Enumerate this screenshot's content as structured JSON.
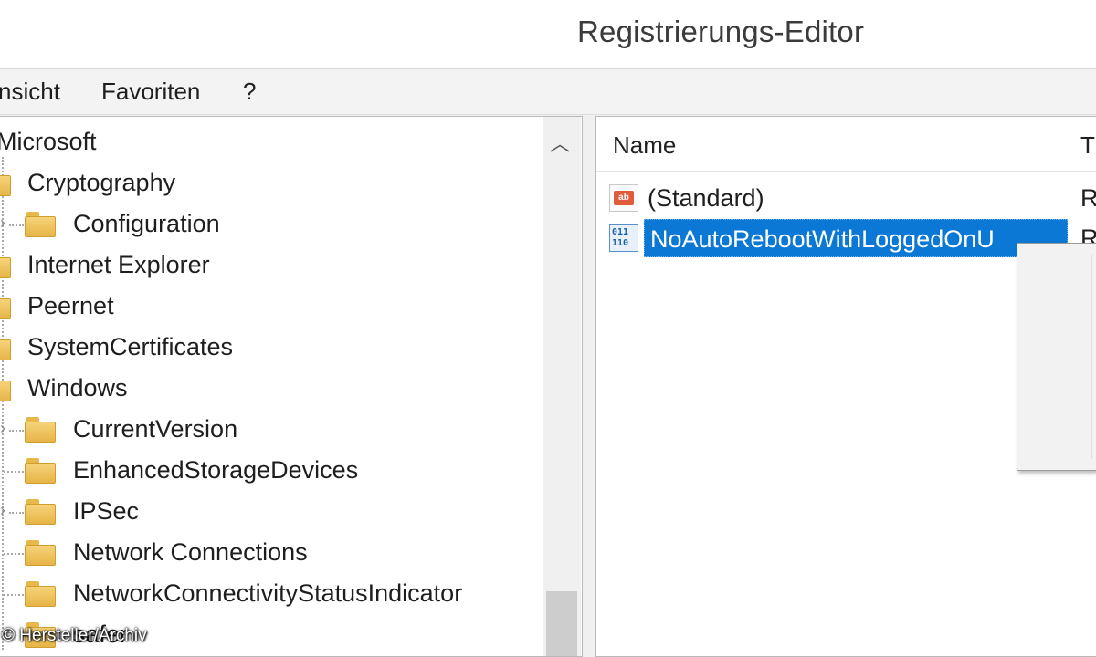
{
  "window": {
    "title": "Registrierungs-Editor"
  },
  "menubar": {
    "items": [
      {
        "label": "nsicht"
      },
      {
        "label": "Favoriten"
      },
      {
        "label": "?"
      }
    ]
  },
  "tree": {
    "items": [
      {
        "label": "Microsoft",
        "level": 0
      },
      {
        "label": "Cryptography",
        "level": 1
      },
      {
        "label": "Configuration",
        "level": 2
      },
      {
        "label": "Internet Explorer",
        "level": 1
      },
      {
        "label": "Peernet",
        "level": 1
      },
      {
        "label": "SystemCertificates",
        "level": 1
      },
      {
        "label": "Windows",
        "level": 1
      },
      {
        "label": "CurrentVersion",
        "level": 2
      },
      {
        "label": "EnhancedStorageDevices",
        "level": 2
      },
      {
        "label": "IPSec",
        "level": 2
      },
      {
        "label": "Network Connections",
        "level": 2
      },
      {
        "label": "NetworkConnectivityStatusIndicator",
        "level": 2
      },
      {
        "label": "safer",
        "level": 2
      }
    ]
  },
  "list": {
    "columns": {
      "name": "Name",
      "type": "T"
    },
    "rows": [
      {
        "name": "(Standard)",
        "type": "R",
        "icon": "reg-sz-icon"
      },
      {
        "name": "NoAutoRebootWithLoggedOnU",
        "type": "R",
        "icon": "reg-dword-icon",
        "selected": true
      }
    ]
  },
  "watermark": "© Hersteller/Archiv"
}
